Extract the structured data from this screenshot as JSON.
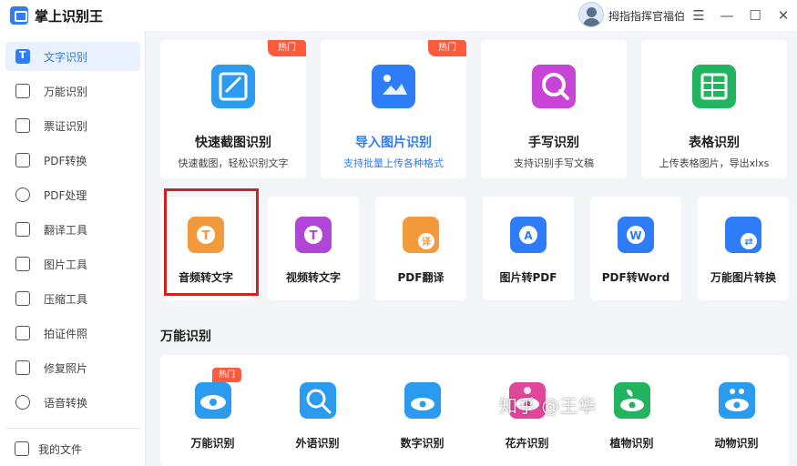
{
  "app": {
    "title": "掌上识别王"
  },
  "user": {
    "name": "拇指指挥官福伯"
  },
  "window": {
    "menu_icon": "☰",
    "minimize_icon": "—",
    "maximize_icon": "☐",
    "close_icon": "✕"
  },
  "sidebar": {
    "items": [
      {
        "label": "文字识别",
        "icon": "text-recognition-icon",
        "active": true
      },
      {
        "label": "万能识别",
        "icon": "scan-icon"
      },
      {
        "label": "票证识别",
        "icon": "ticket-icon"
      },
      {
        "label": "PDF转换",
        "icon": "pdf-convert-icon"
      },
      {
        "label": "PDF处理",
        "icon": "pdf-process-icon"
      },
      {
        "label": "翻译工具",
        "icon": "translate-icon"
      },
      {
        "label": "图片工具",
        "icon": "image-tool-icon"
      },
      {
        "label": "压缩工具",
        "icon": "compress-icon"
      },
      {
        "label": "拍证件照",
        "icon": "id-photo-icon"
      },
      {
        "label": "修复照片",
        "icon": "photo-repair-icon"
      },
      {
        "label": "语音转换",
        "icon": "voice-convert-icon"
      }
    ],
    "bottom": {
      "label": "我的文件",
      "icon": "my-files-icon"
    }
  },
  "main": {
    "big_cards": [
      {
        "title": "快速截图识别",
        "subtitle": "快速截图，轻松识别文字",
        "hot": "热门",
        "icon": "screenshot-icon",
        "color": "#2b9bf0"
      },
      {
        "title": "导入图片识别",
        "subtitle": "支持批量上传各种格式",
        "hot": "热门",
        "icon": "import-image-icon",
        "color": "#2f7df6"
      },
      {
        "title": "手写识别",
        "subtitle": "支持识别手写文稿",
        "icon": "handwriting-icon",
        "color": "#c943d6"
      },
      {
        "title": "表格识别",
        "subtitle": "上传表格图片，导出xlxs",
        "icon": "table-icon",
        "color": "#22b45e"
      }
    ],
    "small_cards": [
      {
        "title": "音频转文字",
        "icon": "audio-to-text-icon",
        "color": "#f39a3c",
        "letter": "T"
      },
      {
        "title": "视频转文字",
        "icon": "video-to-text-icon",
        "color": "#b046d8",
        "letter": "T"
      },
      {
        "title": "PDF翻译",
        "icon": "pdf-translate-icon",
        "color": "#f39a3c",
        "letter": "译"
      },
      {
        "title": "图片转PDF",
        "icon": "image-to-pdf-icon",
        "color": "#2f7df6",
        "letter": "A"
      },
      {
        "title": "PDF转Word",
        "icon": "pdf-to-word-icon",
        "color": "#2f7df6",
        "letter": "W"
      },
      {
        "title": "万能图片转换",
        "icon": "image-convert-icon",
        "color": "#2f7df6",
        "letter": "⇄"
      }
    ],
    "section_title": "万能识别",
    "section_items": [
      {
        "title": "万能识别",
        "hot": "热门",
        "icon": "universal-eye-icon",
        "color": "#2b9bf0"
      },
      {
        "title": "外语识别",
        "icon": "foreign-language-icon",
        "color": "#2b9bf0"
      },
      {
        "title": "数字识别",
        "icon": "number-icon",
        "color": "#2b9bf0"
      },
      {
        "title": "花卉识别",
        "icon": "flower-icon",
        "color": "#e0469a"
      },
      {
        "title": "植物识别",
        "icon": "plant-icon",
        "color": "#22b45e"
      },
      {
        "title": "动物识别",
        "icon": "animal-icon",
        "color": "#2b9bf0"
      }
    ]
  },
  "watermark": "知乎 @王华"
}
